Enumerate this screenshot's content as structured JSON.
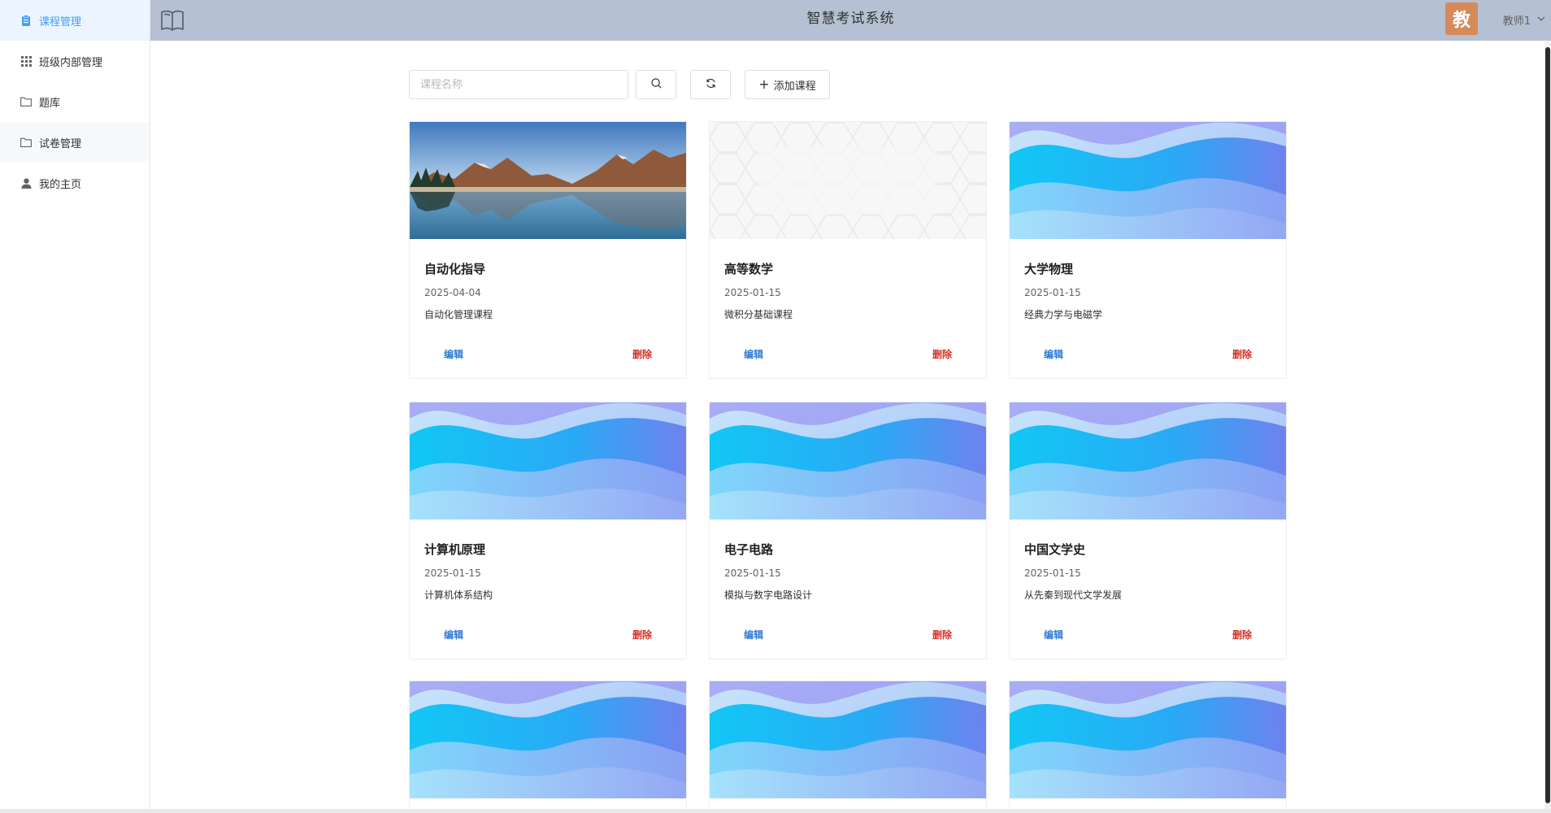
{
  "sidebar": {
    "items": [
      {
        "label": "课程管理",
        "icon": "clipboard-icon"
      },
      {
        "label": "班级内部管理",
        "icon": "grid-icon"
      },
      {
        "label": "题库",
        "icon": "folder-icon"
      },
      {
        "label": "试卷管理",
        "icon": "folder-icon"
      },
      {
        "label": "我的主页",
        "icon": "user-icon"
      }
    ]
  },
  "header": {
    "title": "智慧考试系统",
    "logo_icon": "open-book-icon",
    "avatar_text": "教",
    "user_name": "教师1",
    "caret_icon": "chevron-down-icon"
  },
  "toolbar": {
    "search_placeholder": "课程名称",
    "search_value": "",
    "search_icon": "search-icon",
    "reset_icon": "refresh-icon",
    "add_label": "添加课程",
    "add_icon": "plus-icon"
  },
  "courses": [
    {
      "name": "自动化指导",
      "date": "2025-04-04",
      "description": "自动化管理课程",
      "edit_label": "编辑",
      "delete_label": "删除",
      "image": "mountain-lake"
    },
    {
      "name": "高等数学",
      "date": "2025-01-15",
      "description": "微积分基础课程",
      "edit_label": "编辑",
      "delete_label": "删除",
      "image": "hexagon-pattern"
    },
    {
      "name": "大学物理",
      "date": "2025-01-15",
      "description": "经典力学与电磁学",
      "edit_label": "编辑",
      "delete_label": "删除",
      "image": "blue-waves"
    },
    {
      "name": "计算机原理",
      "date": "2025-01-15",
      "description": "计算机体系结构",
      "edit_label": "编辑",
      "delete_label": "删除",
      "image": "blue-waves"
    },
    {
      "name": "电子电路",
      "date": "2025-01-15",
      "description": "模拟与数字电路设计",
      "edit_label": "编辑",
      "delete_label": "删除",
      "image": "blue-waves"
    },
    {
      "name": "中国文学史",
      "date": "2025-01-15",
      "description": "从先秦到现代文学发展",
      "edit_label": "编辑",
      "delete_label": "删除",
      "image": "blue-waves"
    }
  ],
  "partial_cards": [
    {
      "image": "blue-waves"
    },
    {
      "image": "blue-waves"
    },
    {
      "image": "blue-waves"
    }
  ],
  "colors": {
    "header_bg": "#b5c1d2",
    "active_menu": "#409eff",
    "edit": "#2f7ad6",
    "delete": "#d93025",
    "avatar_bg": "#d68a59"
  }
}
